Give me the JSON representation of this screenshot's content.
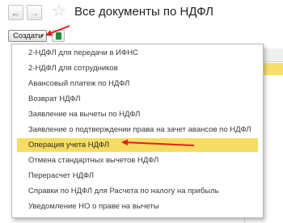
{
  "window": {
    "title": "Все документы по НДФЛ",
    "back_glyph": "←",
    "forward_glyph": "→",
    "star_glyph": "☆"
  },
  "toolbar": {
    "create_label": "Создать",
    "create_chevron": "▾"
  },
  "menu": {
    "items": [
      {
        "label": "2-НДФЛ для передачи в ИФНС"
      },
      {
        "label": "2-НДФЛ для сотрудников"
      },
      {
        "label": "Авансовый платеж по НДФЛ"
      },
      {
        "label": "Возврат НДФЛ"
      },
      {
        "label": "Заявление на вычеты по НДФЛ"
      },
      {
        "label": "Заявление о подтверждении права на зачет авансов по НДФЛ"
      },
      {
        "label": "Операция учета НДФЛ",
        "selected": true
      },
      {
        "label": "Отмена стандартных вычетов НДФЛ"
      },
      {
        "label": "Перерасчет НДФЛ"
      },
      {
        "label": "Справки по НДФЛ для Расчета по налогу на прибыль"
      },
      {
        "label": "Уведомление НО о праве на вычеты"
      }
    ]
  },
  "colors": {
    "selection": "#f6dc62",
    "annotation_arrow": "#e02020"
  },
  "icons": [
    "back-arrow-icon",
    "forward-arrow-icon",
    "star-icon",
    "chevron-down-icon",
    "excel-icon"
  ]
}
